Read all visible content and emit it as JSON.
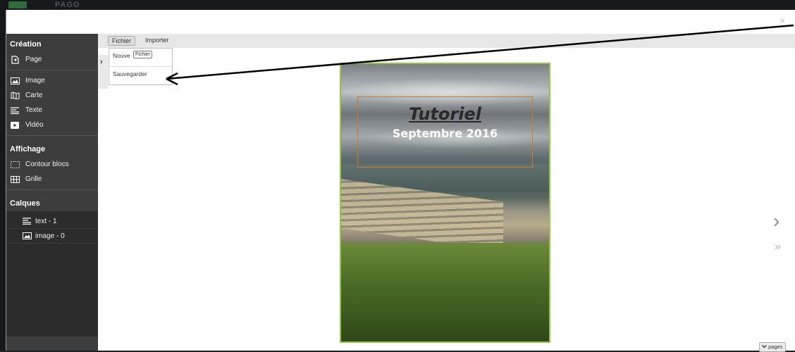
{
  "background": {
    "brand_text": "PAGO"
  },
  "modal": {
    "close": "×"
  },
  "toolbar": {
    "fichier": "Fichier",
    "importer": "Importer"
  },
  "toggle": "›",
  "dropdown": {
    "new": "Nouve",
    "tooltip": "Fichier",
    "save": "Sauvegarder"
  },
  "sidebar": {
    "creation_title": "Création",
    "creation_items": [
      "Page",
      "Image",
      "Carte",
      "Texte",
      "Vidéo"
    ],
    "display_title": "Affichage",
    "display_items": [
      "Contour blocs",
      "Grille"
    ],
    "layers_title": "Calques",
    "layers": [
      "text - 1",
      "image - 0"
    ]
  },
  "canvas": {
    "title": "Tutoriel",
    "subtitle": "Septembre 2016"
  },
  "nav": {
    "next": "›",
    "last": "»",
    "pages": "pages"
  },
  "colors": {
    "sidebar": "#3d3d3d",
    "page_border": "#93c547",
    "text_block_border": "#d07a1e"
  }
}
